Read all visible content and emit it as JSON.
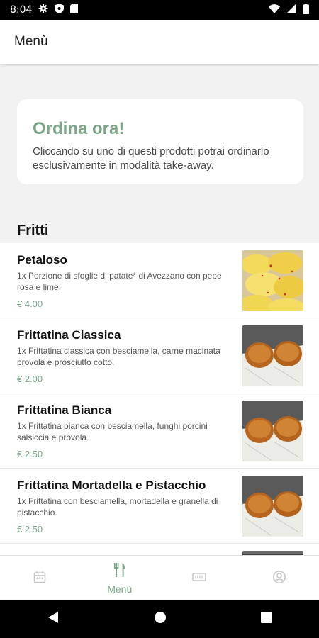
{
  "status_bar": {
    "time": "8:04"
  },
  "app_bar": {
    "title": "Menù"
  },
  "promo": {
    "title": "Ordina ora!",
    "text": "Cliccando su uno di questi prodotti potrai ordinarlo esclusivamente in modalità take-away."
  },
  "section": {
    "title": "Fritti"
  },
  "items": [
    {
      "name": "Petaloso",
      "description": "1x Porzione di sfoglie di patate* di Avezzano con pepe rosa e lime.",
      "price": "€ 4.00"
    },
    {
      "name": "Frittatina Classica",
      "description": "1x Frittatina classica con besciamella, carne macinata provola e prosciutto cotto.",
      "price": "€ 2.00"
    },
    {
      "name": "Frittatina Bianca",
      "description": "1x Frittatina bianca con besciamella, funghi porcini salsiccia e provola.",
      "price": "€ 2.50"
    },
    {
      "name": "Frittatina Mortadella e Pistacchio",
      "description": "1x Frittatina con besciamella, mortadella e granella di pistacchio.",
      "price": "€ 2.50"
    }
  ],
  "bottom_nav": {
    "menu_label": "Menù"
  },
  "colors": {
    "accent": "#7aa688"
  }
}
